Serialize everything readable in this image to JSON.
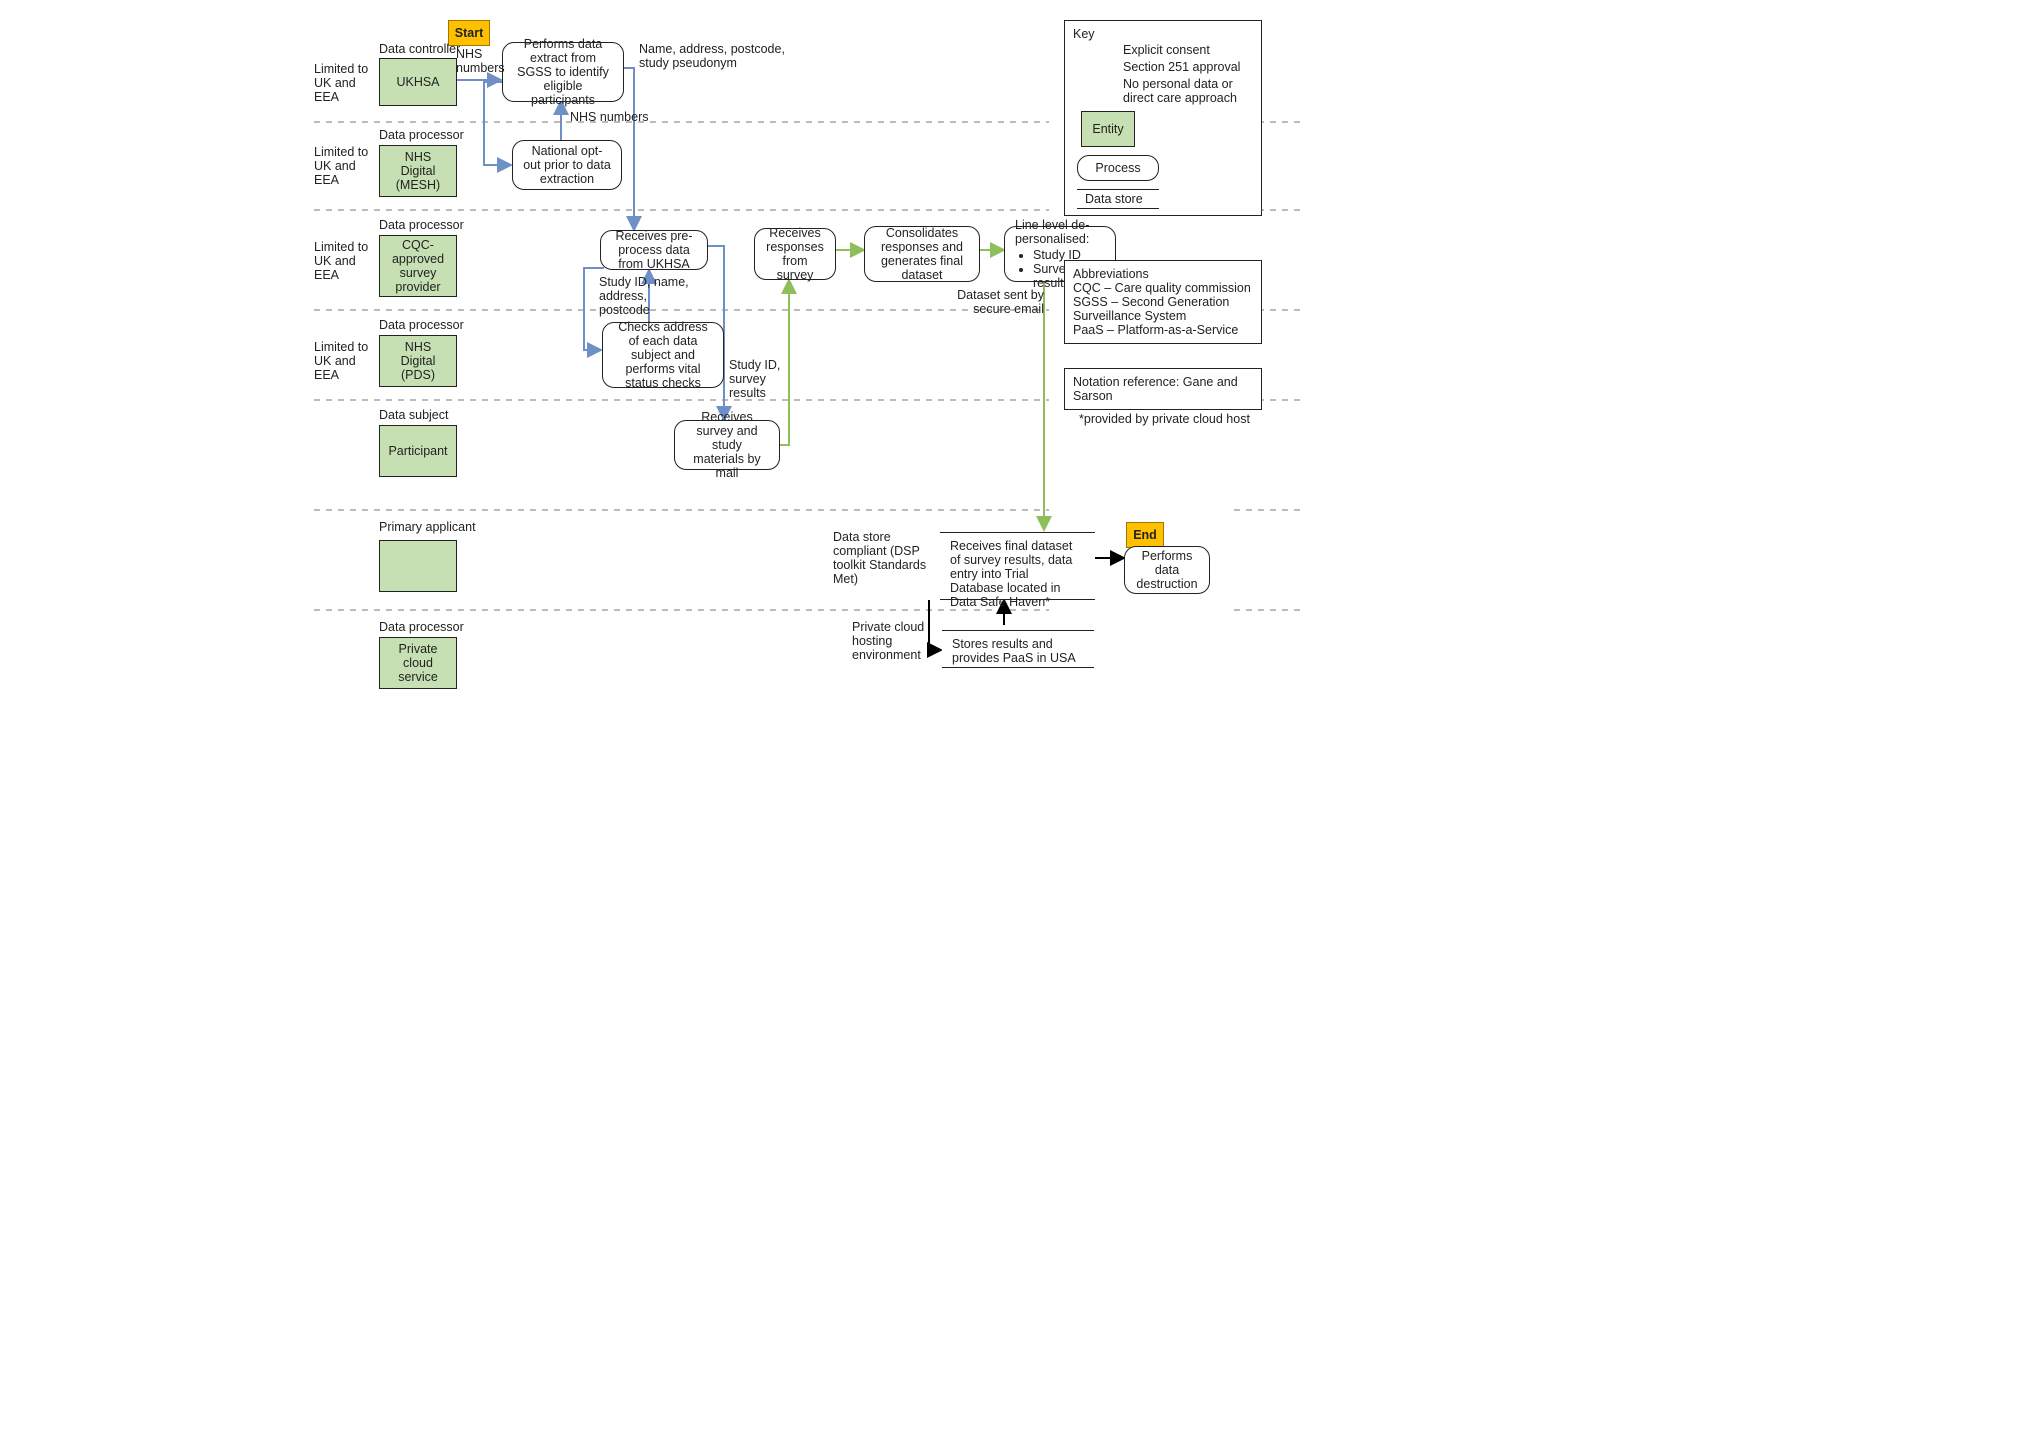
{
  "start": "Start",
  "end": "End",
  "limit_text": "Limited to UK and EEA",
  "roles": {
    "r1": "Data controller",
    "r2": "Data processor",
    "r3": "Data processor",
    "r4": "Data processor",
    "r5": "Data subject",
    "r6": "Primary applicant",
    "r7": "Data processor"
  },
  "entities": {
    "e1": "UKHSA",
    "e2": "NHS Digital (MESH)",
    "e3": "CQC-approved survey provider",
    "e4": "NHS Digital (PDS)",
    "e5": "Participant",
    "e7": "Private cloud service"
  },
  "processes": {
    "p1": "Performs data extract from SGSS to identify eligible participants",
    "p2": "National opt-out prior to data extraction",
    "p3": "Receives pre-process data from UKHSA",
    "p4": "Checks address of each data subject and performs vital status checks",
    "p5": "Receives survey and study materials by mail",
    "p6": "Receives responses from survey",
    "p7": "Consolidates responses and generates final dataset",
    "p8": "Line level de-personalised:",
    "p8_b1": "Study ID",
    "p8_b2": "Survey results",
    "p9": "Performs data destruction"
  },
  "datastores": {
    "d1": "Receives final dataset of survey results, data entry into Trial Database located in Data Safe Haven*",
    "d2": "Stores results and provides PaaS in USA"
  },
  "edge_labels": {
    "l_nhs_left": "NHS numbers",
    "l_nhs_up": "NHS numbers",
    "l_name": "Name, address, postcode, study pseudonym",
    "l_studyid": "Study ID, name, address, postcode",
    "l_studyres": "Study ID, survey results",
    "l_secure": "Dataset sent by secure email",
    "l_dsp": "Data store compliant (DSP toolkit Standards Met)",
    "l_cloud": "Private cloud hosting environment"
  },
  "legend": {
    "title": "Key",
    "k1": "Explicit consent",
    "k2": "Section 251 approval",
    "k3": "No personal data or direct care approach",
    "entity": "Entity",
    "process": "Process",
    "datastore": "Data store"
  },
  "abbrev": "Abbreviations\nCQC – Care quality commission\nSGSS – Second Generation Surveillance System\nPaaS – Platform-as-a-Service",
  "notation": "Notation reference: Gane and Sarson",
  "footnote": "*provided by private cloud host"
}
